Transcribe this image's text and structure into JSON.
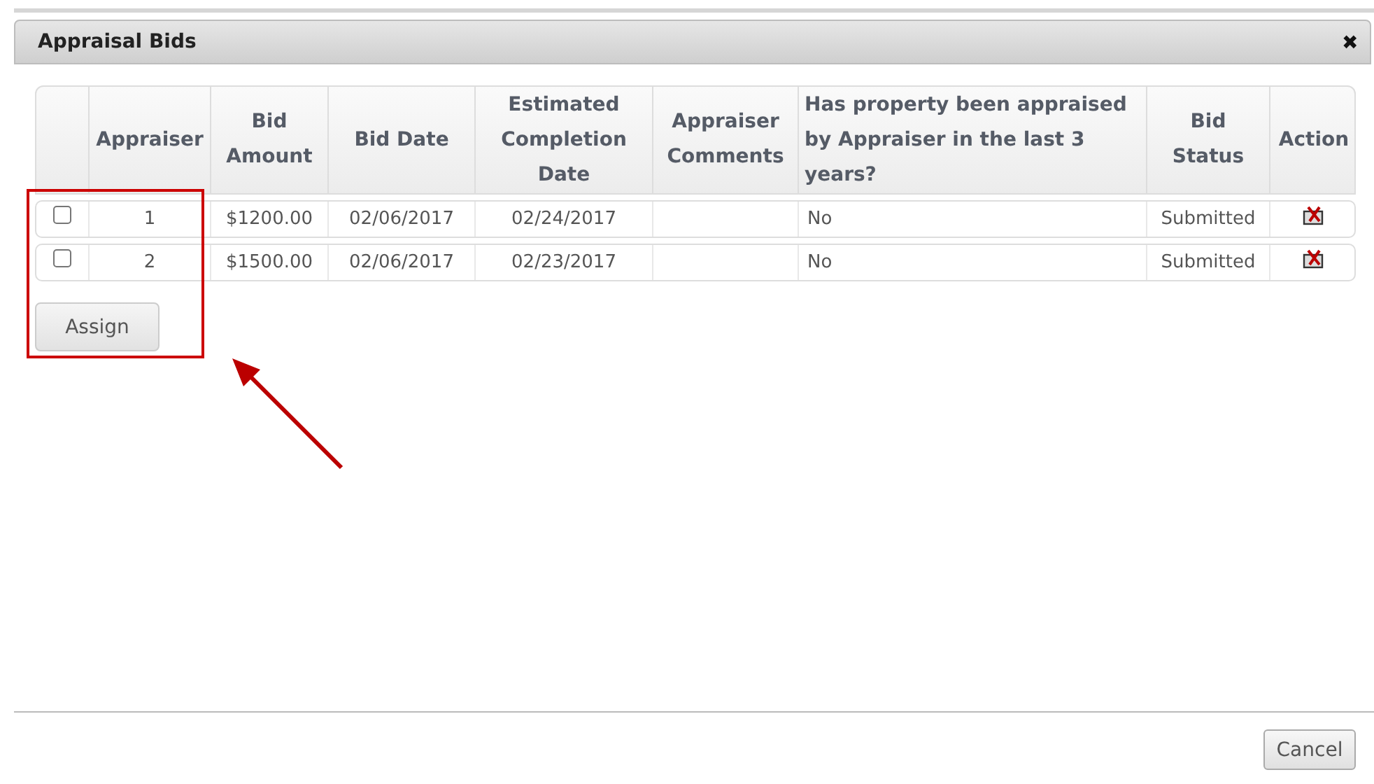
{
  "dialog": {
    "title": "Appraisal Bids",
    "close": "✖"
  },
  "table": {
    "columns": [
      "",
      "Appraiser",
      "Bid Amount",
      "Bid Date",
      "Estimated Completion Date",
      "Appraiser Comments",
      "Has property been appraised by Appraiser in the last 3 years?",
      "Bid Status",
      "Action"
    ],
    "rows": [
      {
        "checked": false,
        "appraiser": "1",
        "amount": "$1200.00",
        "bid_date": "02/06/2017",
        "completion": "02/24/2017",
        "comments": "",
        "appraised": "No",
        "status": "Submitted"
      },
      {
        "checked": false,
        "appraiser": "2",
        "amount": "$1500.00",
        "bid_date": "02/06/2017",
        "completion": "02/23/2017",
        "comments": "",
        "appraised": "No",
        "status": "Submitted"
      }
    ]
  },
  "assign_button": "Assign",
  "cancel_button": "Cancel"
}
